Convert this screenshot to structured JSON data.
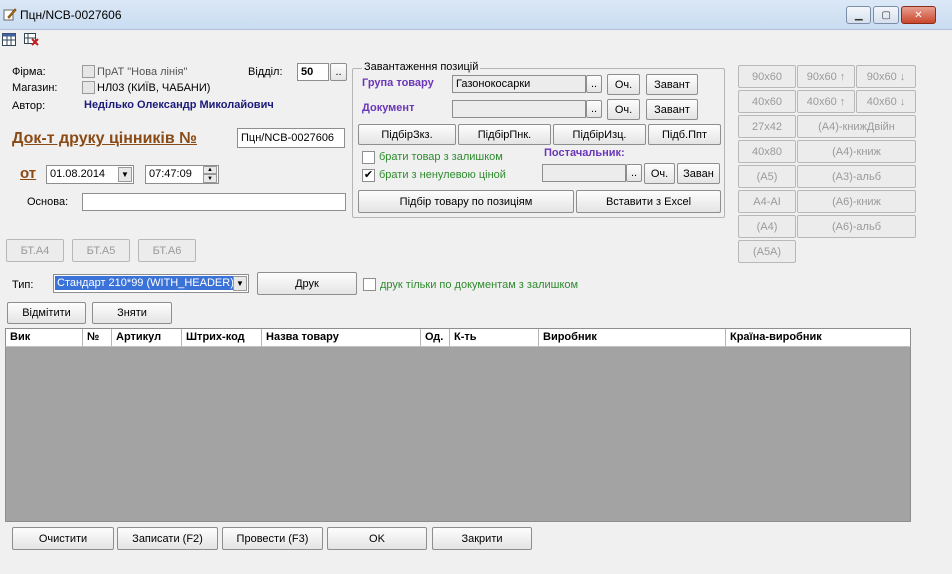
{
  "window": {
    "title": "Пцн/NCB-0027606"
  },
  "header": {
    "firm_label": "Фірма:",
    "firm_value": "ПрАТ \"Нова лінія\"",
    "store_label": "Магазин:",
    "store_value": "НЛ03 (КИЇВ, ЧАБАНИ)",
    "author_label": "Автор:",
    "author_value": "Неділько Олександр Миколайович",
    "dept_label": "Відділ:",
    "dept_value": "50",
    "dept_btn": "..",
    "doc_title": "Док-т друку цінників №",
    "doc_number": "Пцн/NCB-0027606",
    "from_label": "от",
    "date_value": "01.08.2014",
    "time_value": "07:47:09",
    "basis_label": "Основа:",
    "basis_value": ""
  },
  "loading": {
    "title": "Завантаження позицій",
    "group_label": "Група товару",
    "group_value": "Газонокосарки",
    "doc_label": "Документ",
    "doc_value": "",
    "dots": "..",
    "clear": "Оч.",
    "load": "Завант",
    "load_short": "Заван",
    "pick_zks": "ПідбірЗкз.",
    "pick_pnk": "ПідбірПнк.",
    "pick_izc": "ПідбірИзц.",
    "pick_ppt": "Підб.Ппт",
    "check_rest_label": "брати товар з залишком",
    "check_rest": false,
    "check_price_label": "брати з ненулевою ціной",
    "check_price": true,
    "supplier_label": "Постачальник:",
    "supplier_value": "",
    "pick_by_pos": "Підбір товару по позиціям",
    "insert_excel": "Вставити з Excel"
  },
  "formats": [
    [
      "90x60",
      "90x60 ↑",
      "90x60 ↓"
    ],
    [
      "40x60",
      "40x60 ↑",
      "40x60 ↓"
    ],
    [
      "27x42",
      "(А4)-книжДвійн"
    ],
    [
      "40x80",
      "(А4)-книж"
    ],
    [
      "(А5)",
      "(А3)-альб"
    ],
    [
      "А4-АІ",
      "(А6)-книж"
    ],
    [
      "(А4)",
      "(А6)-альб"
    ],
    [
      "(А5А)"
    ]
  ],
  "bt_buttons": [
    "БТ.А4",
    "БТ.А5",
    "БТ.А6"
  ],
  "print": {
    "type_label": "Тип:",
    "type_value": "Стандарт 210*99 (WITH_HEADER)",
    "print_btn": "Друк",
    "only_docs_label": "друк тільки по документам з залишком",
    "only_docs": false
  },
  "marks": {
    "mark": "Відмітити",
    "unmark": "Зняти"
  },
  "grid": {
    "columns": [
      "Вик",
      "№",
      "Артикул",
      "Штрих-код",
      "Назва товару",
      "Од.",
      "К-ть",
      "Виробник",
      "Країна-виробник"
    ]
  },
  "footer": {
    "clear": "Очистити",
    "save": "Записати (F2)",
    "post": "Провести (F3)",
    "ok": "OK",
    "close": "Закрити"
  },
  "icons": {
    "app": "document-edit-icon",
    "toolbar1": "calendar-table-icon",
    "toolbar2": "delete-table-icon"
  }
}
